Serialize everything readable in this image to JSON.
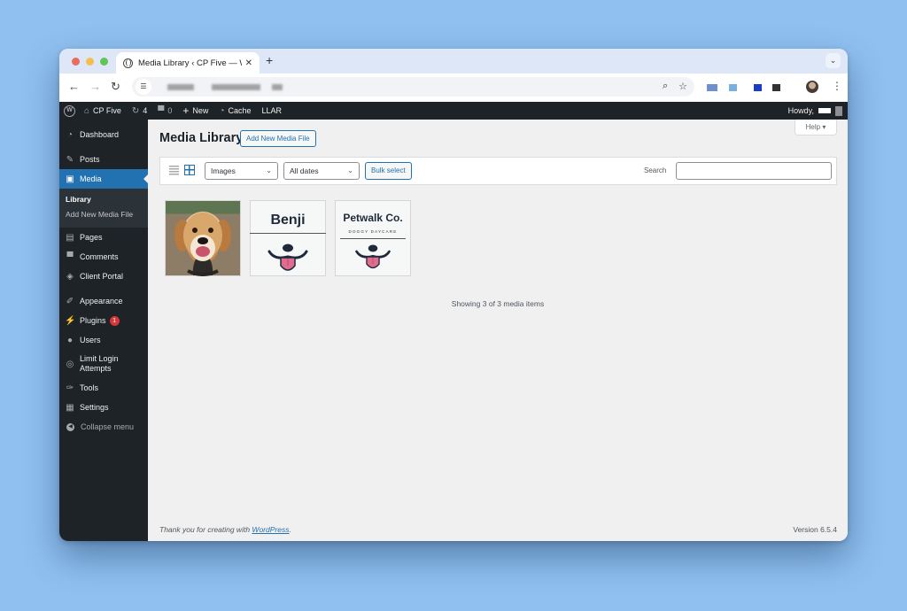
{
  "browser": {
    "tab_title": "Media Library ‹ CP Five — Wo",
    "tab_close_icon": "close-icon",
    "new_tab_label": "+",
    "tab_menu_label": "⌄",
    "nav": {
      "back": "←",
      "forward": "→",
      "reload": "↻"
    },
    "zoom_icon": "⌕",
    "bookmark_icon": "☆",
    "menu_icon": "⋮",
    "extension_colors": [
      "#6f8fd0",
      "#7ab0e0",
      "#1b3cc4",
      "#333333"
    ]
  },
  "adminbar": {
    "site_name": "CP Five",
    "updates_count": "4",
    "comments_count": "0",
    "new_label": "New",
    "cache_label": "Cache",
    "llar_label": "LLAR",
    "howdy_label": "Howdy,"
  },
  "sidebar": {
    "items": [
      {
        "label": "Dashboard",
        "icon": "dashboard-icon",
        "glyph": "◔"
      },
      {
        "label": "Posts",
        "icon": "pin-icon",
        "glyph": "✎"
      },
      {
        "label": "Media",
        "icon": "media-icon",
        "glyph": "▣"
      },
      {
        "label": "Pages",
        "icon": "pages-icon",
        "glyph": "▤"
      },
      {
        "label": "Comments",
        "icon": "comment-icon",
        "glyph": "▀"
      },
      {
        "label": "Client Portal",
        "icon": "portal-icon",
        "glyph": "◈"
      },
      {
        "label": "Appearance",
        "icon": "brush-icon",
        "glyph": "✐"
      },
      {
        "label": "Plugins",
        "icon": "plugin-icon",
        "glyph": "⚡",
        "badge": "1"
      },
      {
        "label": "Users",
        "icon": "user-icon",
        "glyph": "●"
      },
      {
        "label": "Limit Login Attempts",
        "icon": "fingerprint-icon",
        "glyph": "◎"
      },
      {
        "label": "Tools",
        "icon": "wrench-icon",
        "glyph": "✑"
      },
      {
        "label": "Settings",
        "icon": "settings-icon",
        "glyph": "▦"
      },
      {
        "label": "Collapse menu",
        "icon": "collapse-icon",
        "glyph": "◀"
      }
    ],
    "submenu": [
      {
        "label": "Library"
      },
      {
        "label": "Add New Media File"
      }
    ]
  },
  "main": {
    "help_label": "Help ▾",
    "title": "Media Library",
    "add_new_label": "Add New Media File",
    "filter_type": "Images",
    "filter_date": "All dates",
    "bulk_select_label": "Bulk select",
    "search_label": "Search",
    "search_value": "",
    "attachments": [
      {
        "type": "photo",
        "alt": "Beagle dog photo"
      },
      {
        "type": "logo",
        "text": "Benji"
      },
      {
        "type": "logo",
        "text": "Petwalk Co.",
        "subtitle": "DOGGY DAYCARE"
      }
    ],
    "showing_text": "Showing 3 of 3 media items",
    "accent_color": "#2271b1"
  },
  "footer": {
    "thanks_prefix": "Thank you for creating with ",
    "wordpress_link": "WordPress",
    "thanks_suffix": ".",
    "version": "Version 6.5.4"
  }
}
